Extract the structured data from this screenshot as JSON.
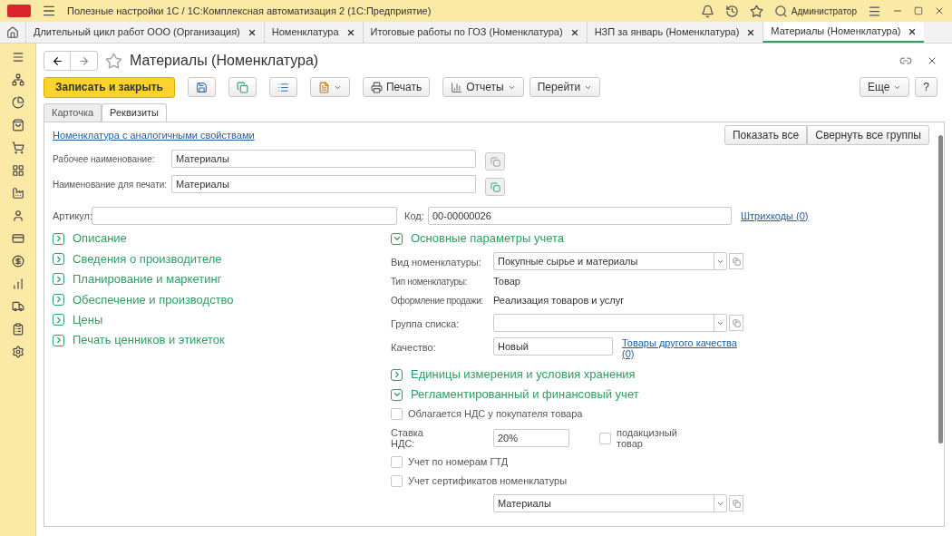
{
  "window": {
    "title": "Полезные настройки 1С / 1С:Комплексная автоматизация 2  (1С:Предприятие)",
    "user": "Администратор"
  },
  "tabs": [
    {
      "label": "Длительный цикл работ ООО (Организация)",
      "selected": false
    },
    {
      "label": "Номенклатура",
      "selected": false
    },
    {
      "label": "Итоговые работы по ГОЗ (Номенклатура)",
      "selected": false
    },
    {
      "label": "НЗП за январь (Номенклатура)",
      "selected": false
    },
    {
      "label": "Материалы (Номенклатура)",
      "selected": true
    }
  ],
  "form": {
    "title": "Материалы (Номенклатура)",
    "toolbar": {
      "save_close": "Записать и закрыть",
      "print": "Печать",
      "reports": "Отчеты",
      "goto": "Перейти",
      "more": "Еще",
      "help": "?"
    },
    "tabs": [
      {
        "label": "Карточка",
        "selected": false
      },
      {
        "label": "Реквизиты",
        "selected": true
      }
    ],
    "link": "Номенклатура с аналогичными свойствами",
    "show_all": "Показать все",
    "collapse_all": "Свернуть все группы",
    "work_name": {
      "label": "Рабочее наименование:",
      "value": "Материалы"
    },
    "print_name": {
      "label": "Наименование для печати:",
      "value": "Материалы"
    },
    "article": {
      "label": "Артикул:"
    },
    "code": {
      "label": "Код:",
      "value": "00-00000026"
    },
    "barcodes": "Штрихкоды (0)",
    "left_groups": [
      {
        "label": "Описание",
        "expanded": false
      },
      {
        "label": "Сведения о производителе",
        "expanded": false
      },
      {
        "label": "Планирование и маркетинг",
        "expanded": false
      },
      {
        "label": "Обеспечение и производство",
        "expanded": false
      },
      {
        "label": "Цены",
        "expanded": false
      },
      {
        "label": "Печать ценников и этикеток",
        "expanded": false
      }
    ],
    "right": [
      {
        "kind": "group",
        "label": "Основные параметры учета",
        "expanded": true
      },
      {
        "kind": "select",
        "label": "Вид номенклатуры:",
        "value": "Покупные сырье и материалы"
      },
      {
        "kind": "info",
        "label": "Тип номенклатуры:",
        "value": "Товар"
      },
      {
        "kind": "info",
        "label": "Оформление продажи:",
        "value": "Реализация товаров и услуг"
      },
      {
        "kind": "select",
        "label": "Группа списка:"
      },
      {
        "kind": "quality",
        "label": "Качество:",
        "value": "Новый",
        "link": "Товары другого качества (0)"
      },
      {
        "kind": "group",
        "label": "Единицы измерения и условия хранения",
        "expanded": false
      },
      {
        "kind": "group",
        "label": "Регламентированный и финансовый учет",
        "expanded": true
      },
      {
        "kind": "check",
        "label": "Облагается НДС у покупателя товара",
        "checked": false
      },
      {
        "kind": "vat",
        "label": "Ставка НДС:",
        "value": "20%",
        "check_label": "подакцизный товар",
        "checked": false
      },
      {
        "kind": "check",
        "label": "Учет по номерам ГТД",
        "checked": false
      },
      {
        "kind": "check",
        "label": "Учет сертификатов номенклатуры",
        "checked": false
      },
      {
        "kind": "select",
        "value": "Материалы"
      }
    ]
  }
}
